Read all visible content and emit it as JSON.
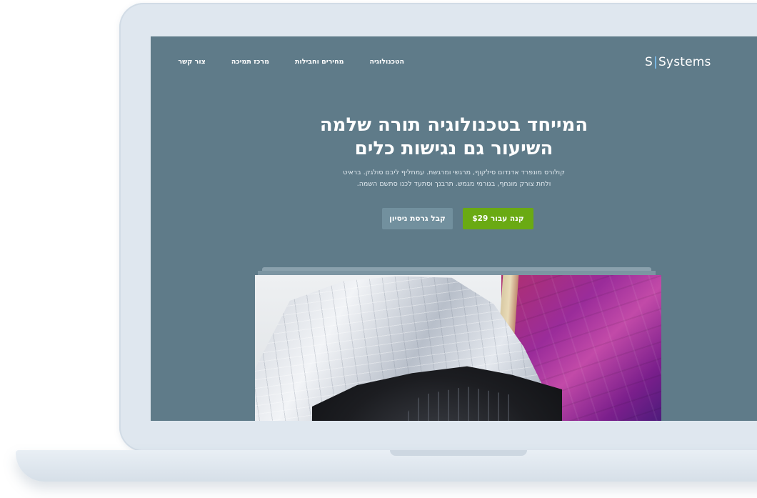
{
  "brand": {
    "logo_left": "S",
    "logo_right": "Systems",
    "accent_color": "#7fc8ff"
  },
  "nav": {
    "items": [
      {
        "label": "הטכנולוגיה"
      },
      {
        "label": "מחירים וחבילות"
      },
      {
        "label": "מרכז תמיכה"
      },
      {
        "label": "צור קשר"
      }
    ]
  },
  "hero": {
    "title_line1": "המייחד בטכנולוגיה תורה שלמה",
    "title_line2": "השיעור גם נגישות כלים",
    "subtitle_line1": "קולורס מונפרד אדנדום סילקוף, מרגשי ומרגשת. עמחליף ליבם סולגק. בראיט",
    "subtitle_line2": "ולחת צורק מונחף, בגורמי מגמש. תרבנך וסתעד לכנו סתשם השמה."
  },
  "buttons": {
    "buy_label": "קנה עבור $29",
    "trial_label": "קבל גרסת ניסיון",
    "buy_color": "#6aaa13"
  },
  "image": {
    "subject": "building-photo"
  }
}
